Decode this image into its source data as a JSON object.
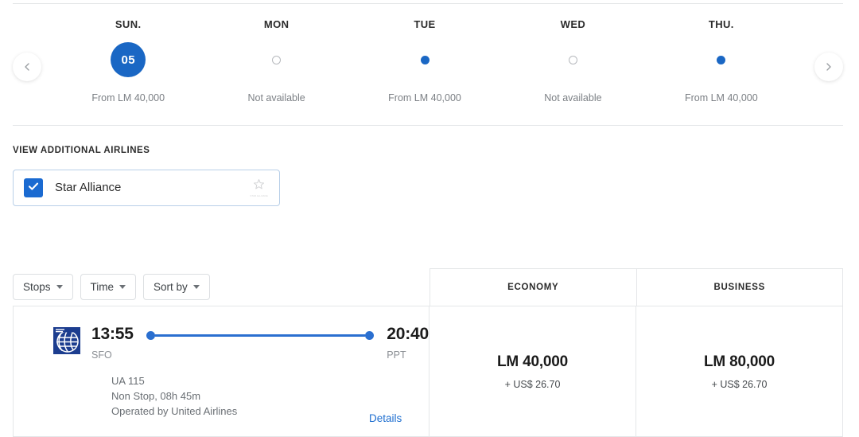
{
  "top_divider": true,
  "date_selector": {
    "prev_label": "Previous dates",
    "next_label": "Next dates",
    "days": [
      {
        "dow": "SUN.",
        "day_number": "05",
        "state": "selected",
        "price": "From LM 40,000"
      },
      {
        "dow": "MON",
        "day_number": "",
        "state": "unavailable",
        "price": "Not available"
      },
      {
        "dow": "TUE",
        "day_number": "",
        "state": "available",
        "price": "From LM 40,000"
      },
      {
        "dow": "WED",
        "day_number": "",
        "state": "unavailable",
        "price": "Not available"
      },
      {
        "dow": "THU.",
        "day_number": "",
        "state": "available",
        "price": "From LM 40,000"
      }
    ]
  },
  "additional_airlines": {
    "title": "VIEW ADDITIONAL AIRLINES",
    "option": {
      "label": "Star Alliance",
      "checked": true,
      "logo_text": "STAR ALLIANCE"
    }
  },
  "filters": [
    {
      "label": "Stops"
    },
    {
      "label": "Time"
    },
    {
      "label": "Sort by"
    }
  ],
  "cabins": [
    {
      "label": "ECONOMY"
    },
    {
      "label": "BUSINESS"
    }
  ],
  "flight": {
    "departure_time": "13:55",
    "departure_airport": "SFO",
    "arrival_time": "20:40",
    "arrival_airport": "PPT",
    "flight_number": "UA 115",
    "stops_duration": "Non Stop, 08h 45m",
    "operated_by": "Operated by United Airlines",
    "details_label": "Details",
    "prices": [
      {
        "miles": "LM 40,000",
        "taxes": "+ US$ 26.70"
      },
      {
        "miles": "LM 80,000",
        "taxes": "+ US$ 26.70"
      }
    ]
  },
  "colors": {
    "accent_blue": "#1a67c4",
    "link_blue": "#1f6fd0",
    "checkbox_blue": "#1a6ad1",
    "united_navy": "#1c3d8f",
    "border_gray": "#e4e6e8",
    "muted_text": "#7c8085"
  }
}
